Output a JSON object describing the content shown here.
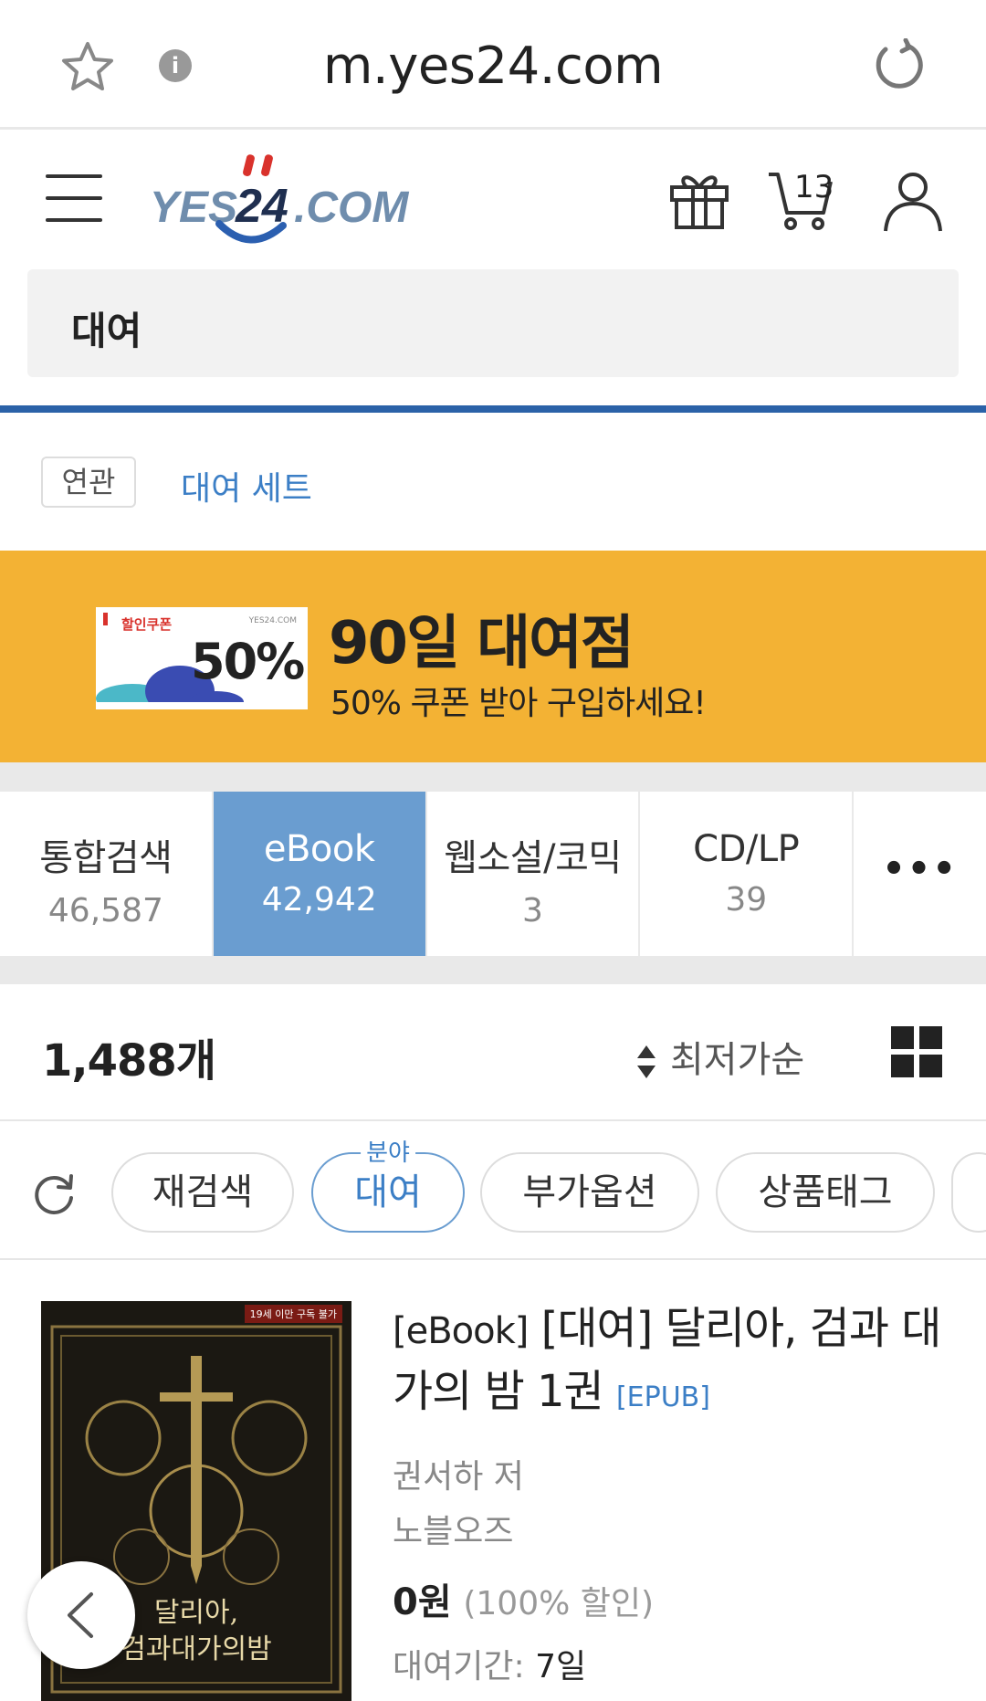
{
  "browser": {
    "url": "m.yes24.com",
    "bookmark_icon": "star-icon",
    "info_icon": "info-icon",
    "reload_icon": "reload-icon",
    "info_glyph": "i"
  },
  "header": {
    "logo_text": "YES24.COM",
    "logo_brand": "YES",
    "logo_num": "24",
    "logo_suffix": ".COM",
    "cart_count": "13"
  },
  "search": {
    "query": "대여"
  },
  "related": {
    "tag": "연관",
    "link": "대여 세트"
  },
  "banner": {
    "coupon_label": "할인쿠폰",
    "coupon_logo": "YES24.COM",
    "coupon_percent": "50%",
    "title": "90일 대여점",
    "subtitle": "50% 쿠폰 받아 구입하세요!"
  },
  "tabs": [
    {
      "label": "통합검색",
      "count": "46,587"
    },
    {
      "label": "eBook",
      "count": "42,942"
    },
    {
      "label": "웹소설/코믹",
      "count": "3"
    },
    {
      "label": "CD/LP",
      "count": "39"
    }
  ],
  "tabs_more": "•••",
  "results": {
    "count": "1,488개",
    "sort": "최저가순"
  },
  "filters": {
    "research": "재검색",
    "category_caption": "분야",
    "category": "대여",
    "options": "부가옵션",
    "tags": "상품태그"
  },
  "product": {
    "prefix": "[eBook]",
    "title": "[대여] 달리아, 검과 대가의 밤 1권",
    "format": "[EPUB]",
    "author": "권서하 저",
    "publisher": "노블오즈",
    "price": "0원",
    "discount": "(100% 할인)",
    "rental_label": "대여기간:",
    "rental_value": "7일",
    "cover_badge": "19세 이만 구독 불가",
    "cover_title_line1": "달리아,",
    "cover_title_line2": "검과대가의밤"
  },
  "colors": {
    "brand_blue": "#2b62a8",
    "active_tab": "#6a9dd0",
    "banner": "#f3b234",
    "link_blue": "#3c7fc6",
    "logo_red": "#d9322c"
  }
}
